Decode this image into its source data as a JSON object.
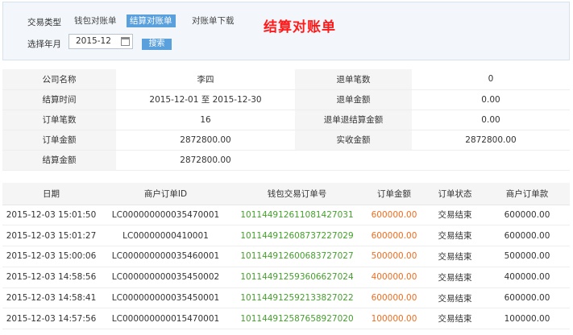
{
  "filter": {
    "type_label": "交易类型",
    "tabs": [
      "钱包对账单",
      "结算对账单",
      "对账单下载"
    ],
    "active_tab": "结算对账单",
    "heading": "结算对账单",
    "month_label": "选择年月",
    "month_value": "2015-12",
    "search_label": "搜索"
  },
  "summary": {
    "rows": [
      [
        {
          "k": "公司名称",
          "v": "李四"
        },
        {
          "k": "退单笔数",
          "v": "0"
        }
      ],
      [
        {
          "k": "结算时间",
          "v": "2015-12-01 至 2015-12-30"
        },
        {
          "k": "退单金额",
          "v": "0.00"
        }
      ],
      [
        {
          "k": "订单笔数",
          "v": "16"
        },
        {
          "k": "退单退结算金额",
          "v": "0.00"
        }
      ],
      [
        {
          "k": "订单金额",
          "v": "2872800.00"
        },
        {
          "k": "实收金额",
          "v": "2872800.00"
        }
      ],
      [
        {
          "k": "结算金额",
          "v": "2872800.00"
        },
        {
          "k": "",
          "v": ""
        }
      ]
    ]
  },
  "orders": {
    "columns": [
      "日期",
      "商户订单ID",
      "钱包交易订单号",
      "订单金额",
      "订单状态",
      "商户订单款"
    ],
    "rows": [
      [
        "2015-12-03 15:01:50",
        "LC000000000035470001",
        "1011449126110814270 31",
        "600000.00",
        "交易结束",
        "600000.00"
      ],
      [
        "2015-12-03 15:01:27",
        "LC00000000410001",
        "101144912608737227029",
        "600000.00",
        "交易结束",
        "600000.00"
      ],
      [
        "2015-12-03 15:00:06",
        "LC000000000035460001",
        "101144912600683727027",
        "500000.00",
        "交易结束",
        "500000.00"
      ],
      [
        "2015-12-03 14:58:56",
        "LC000000000035450002",
        "101144912593606627024",
        "400000.00",
        "交易结束",
        "400000.00"
      ],
      [
        "2015-12-03 14:58:41",
        "LC000000000035450001",
        "101144912592133827022",
        "600000.00",
        "交易结束",
        "600000.00"
      ],
      [
        "2015-12-03 14:57:56",
        "LC000000000015470001",
        "101144912587658927020",
        "100000.00",
        "交易结束",
        "100000.00"
      ]
    ]
  }
}
